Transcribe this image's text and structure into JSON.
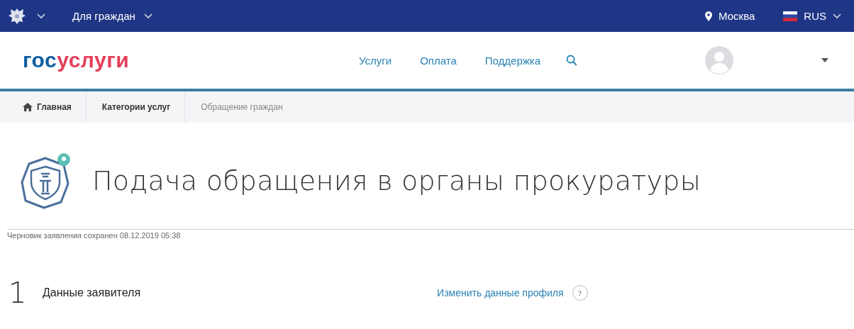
{
  "top_bar": {
    "audience": "Для граждан",
    "location": "Москва",
    "language": "RUS"
  },
  "header": {
    "logo": {
      "part_1": "гос",
      "part_2": "услуги"
    },
    "nav": [
      {
        "label": "Услуги",
        "kind": "link"
      },
      {
        "label": "Оплата",
        "kind": "link"
      },
      {
        "label": "Поддержка",
        "kind": "link"
      },
      {
        "kind": "search"
      }
    ]
  },
  "breadcrumbs": [
    {
      "label": "Главная",
      "kind": "home"
    },
    {
      "label": "Категории услуг",
      "kind": "link"
    },
    {
      "label": "Обращение граждан",
      "kind": "current"
    }
  ],
  "page": {
    "title": "Подача обращения в органы прокуратуры",
    "draft_note": "Черновик заявления сохранен 08.12.2019 05:38"
  },
  "step": {
    "number": "1",
    "title": "Данные заявителя",
    "link": "Изменить данные профиля",
    "help": "?"
  }
}
